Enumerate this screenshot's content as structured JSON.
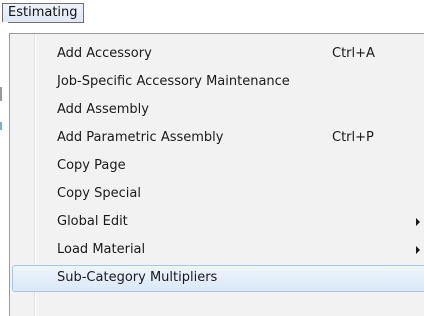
{
  "menubar": {
    "title": "Estimating"
  },
  "menu": {
    "items": [
      {
        "label": "Add Accessory",
        "shortcut": "Ctrl+A",
        "submenu": false
      },
      {
        "label": "Job-Specific Accessory Maintenance",
        "shortcut": "",
        "submenu": false
      },
      {
        "label": "Add Assembly",
        "shortcut": "",
        "submenu": false
      },
      {
        "label": "Add Parametric Assembly",
        "shortcut": "Ctrl+P",
        "submenu": false
      },
      {
        "label": "Copy Page",
        "shortcut": "",
        "submenu": false
      },
      {
        "label": "Copy Special",
        "shortcut": "",
        "submenu": false
      },
      {
        "label": "Global Edit",
        "shortcut": "",
        "submenu": true,
        "icon": "chevron-right-icon"
      },
      {
        "label": "Load Material",
        "shortcut": "",
        "submenu": true,
        "icon": "chevron-right-icon"
      },
      {
        "label": "Sub-Category Multipliers",
        "shortcut": "",
        "submenu": false,
        "state": "highlighted"
      }
    ]
  },
  "colors": {
    "menu_background": "#f2f2f2",
    "highlight": "#dbe8f7",
    "highlight_border": "#a9c5ea"
  }
}
